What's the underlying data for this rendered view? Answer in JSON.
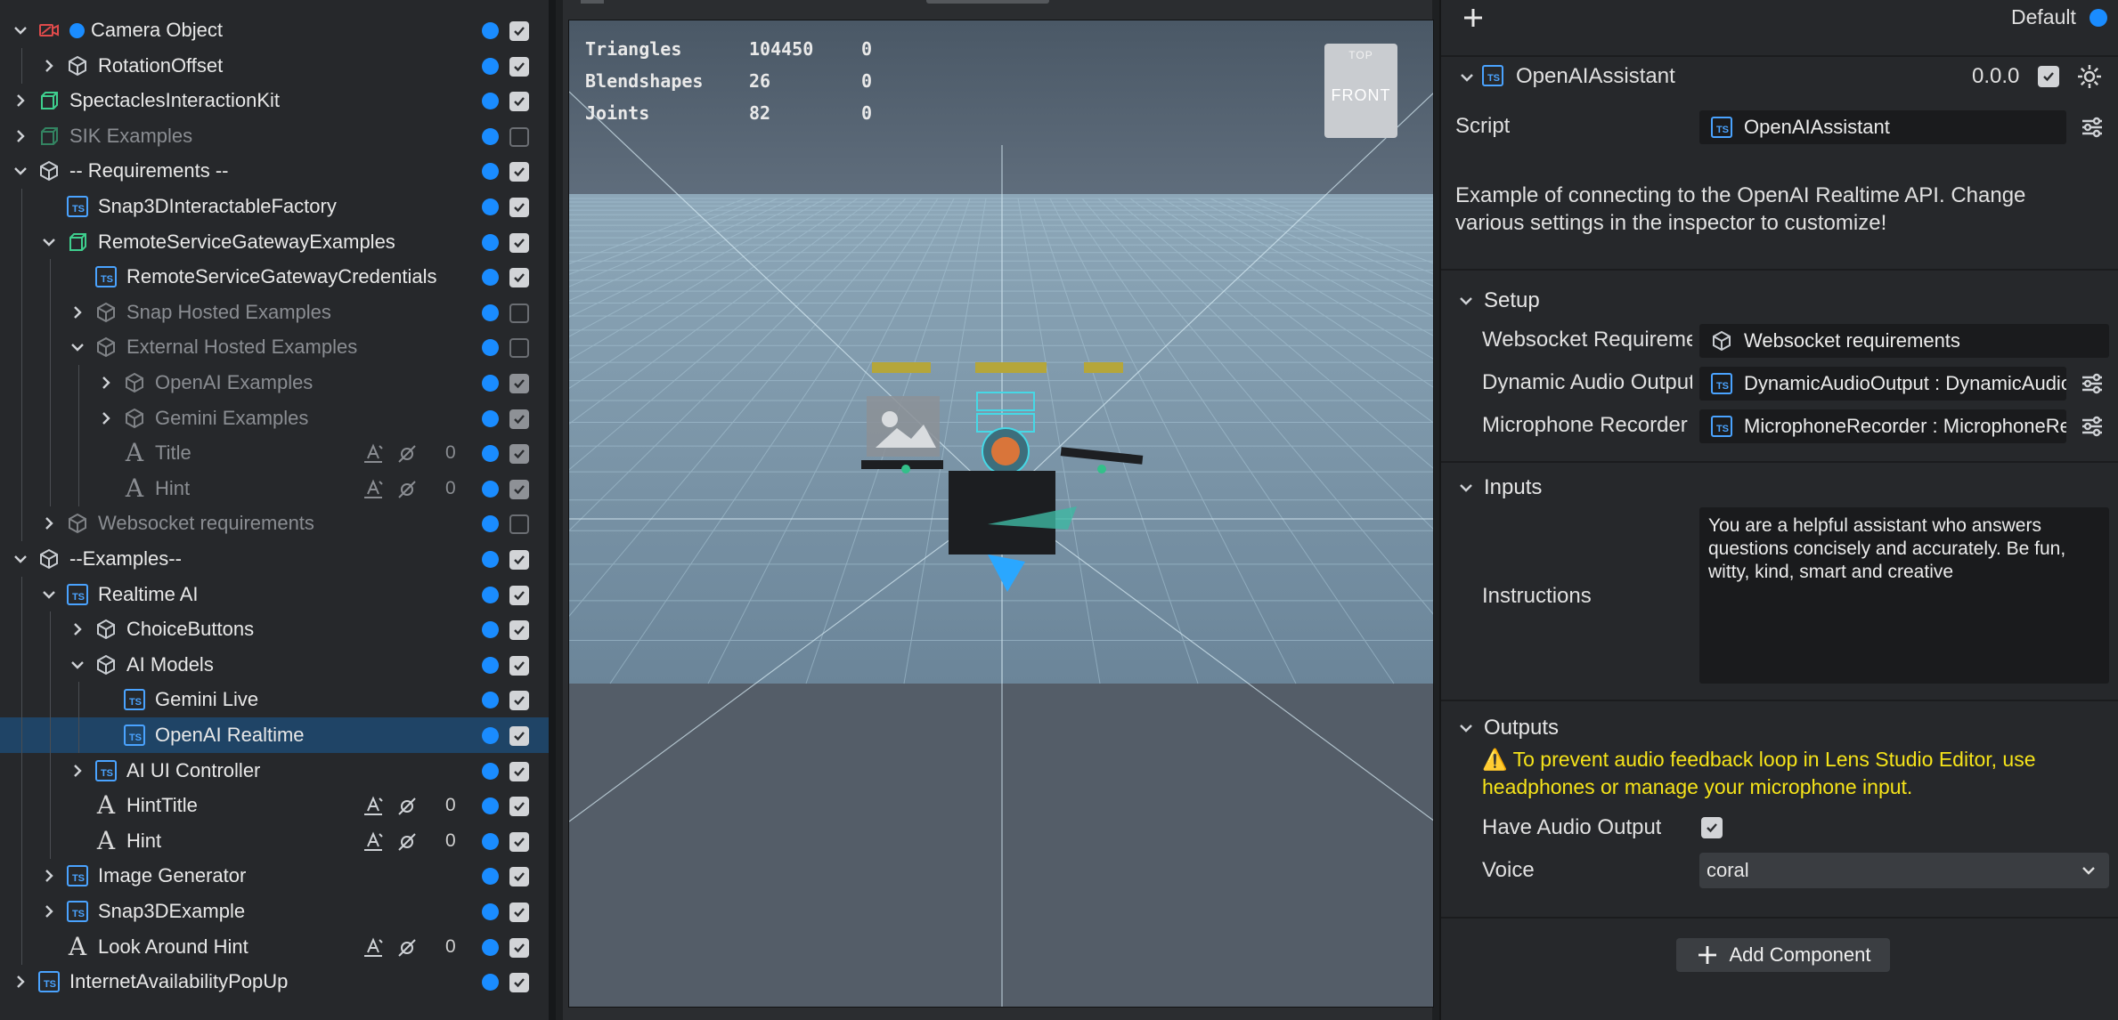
{
  "hierarchy": {
    "rows": [
      {
        "label": "Camera Object",
        "depth": 0,
        "expander": "open",
        "icon": "camera-icon",
        "dim": false,
        "enabled": true,
        "dot": true
      },
      {
        "label": "RotationOffset",
        "depth": 1,
        "expander": "closed",
        "icon": "object-icon",
        "dim": false,
        "enabled": true
      },
      {
        "label": "SpectaclesInteractionKit",
        "depth": 0,
        "expander": "closed",
        "icon": "prefab-icon",
        "dim": false,
        "enabled": true
      },
      {
        "label": "SIK Examples",
        "depth": 0,
        "expander": "closed",
        "icon": "prefab-icon",
        "dim": true,
        "enabled": false
      },
      {
        "label": "-- Requirements --",
        "depth": 0,
        "expander": "open",
        "icon": "object-icon",
        "dim": false,
        "enabled": true
      },
      {
        "label": "Snap3DInteractableFactory",
        "depth": 1,
        "expander": "none",
        "icon": "script-icon",
        "dim": false,
        "enabled": true
      },
      {
        "label": "RemoteServiceGatewayExamples",
        "depth": 1,
        "expander": "open",
        "icon": "prefab-icon",
        "dim": false,
        "enabled": true
      },
      {
        "label": "RemoteServiceGatewayCredentials",
        "depth": 2,
        "expander": "none",
        "icon": "script-icon",
        "dim": false,
        "enabled": true
      },
      {
        "label": "Snap Hosted Examples",
        "depth": 2,
        "expander": "closed",
        "icon": "object-icon",
        "dim": true,
        "enabled": false
      },
      {
        "label": "External Hosted Examples",
        "depth": 2,
        "expander": "open",
        "icon": "object-icon",
        "dim": true,
        "enabled": false
      },
      {
        "label": "OpenAI Examples",
        "depth": 3,
        "expander": "closed",
        "icon": "object-icon",
        "dim": true,
        "enabled": true
      },
      {
        "label": "Gemini Examples",
        "depth": 3,
        "expander": "closed",
        "icon": "object-icon",
        "dim": true,
        "enabled": true
      },
      {
        "label": "Title",
        "depth": 3,
        "expander": "none",
        "icon": "text-icon",
        "dim": true,
        "enabled": true,
        "tools": true,
        "count": "0"
      },
      {
        "label": "Hint",
        "depth": 3,
        "expander": "none",
        "icon": "text-icon",
        "dim": true,
        "enabled": true,
        "tools": true,
        "count": "0"
      },
      {
        "label": "Websocket requirements",
        "depth": 1,
        "expander": "closed",
        "icon": "object-icon",
        "dim": true,
        "enabled": false
      },
      {
        "label": "--Examples--",
        "depth": 0,
        "expander": "open",
        "icon": "object-icon",
        "dim": false,
        "enabled": true
      },
      {
        "label": "Realtime AI",
        "depth": 1,
        "expander": "open",
        "icon": "script-icon",
        "dim": false,
        "enabled": true
      },
      {
        "label": "ChoiceButtons",
        "depth": 2,
        "expander": "closed",
        "icon": "object-icon",
        "dim": false,
        "enabled": true
      },
      {
        "label": "AI Models",
        "depth": 2,
        "expander": "open",
        "icon": "object-icon",
        "dim": false,
        "enabled": true
      },
      {
        "label": "Gemini Live",
        "depth": 3,
        "expander": "none",
        "icon": "script-icon",
        "dim": false,
        "enabled": true
      },
      {
        "label": "OpenAI Realtime",
        "depth": 3,
        "expander": "none",
        "icon": "script-icon",
        "dim": false,
        "enabled": true,
        "selected": true
      },
      {
        "label": "AI UI Controller",
        "depth": 2,
        "expander": "closed",
        "icon": "script-icon",
        "dim": false,
        "enabled": true
      },
      {
        "label": "HintTitle",
        "depth": 2,
        "expander": "none",
        "icon": "text-icon",
        "dim": false,
        "enabled": true,
        "tools": true,
        "count": "0"
      },
      {
        "label": "Hint",
        "depth": 2,
        "expander": "none",
        "icon": "text-icon",
        "dim": false,
        "enabled": true,
        "tools": true,
        "count": "0"
      },
      {
        "label": "Image Generator",
        "depth": 1,
        "expander": "closed",
        "icon": "script-icon",
        "dim": false,
        "enabled": true
      },
      {
        "label": "Snap3DExample",
        "depth": 1,
        "expander": "closed",
        "icon": "script-icon",
        "dim": false,
        "enabled": true
      },
      {
        "label": "Look Around Hint",
        "depth": 1,
        "expander": "none",
        "icon": "text-icon",
        "dim": false,
        "enabled": true,
        "tools": true,
        "count": "0"
      },
      {
        "label": "InternetAvailabilityPopUp",
        "depth": 0,
        "expander": "closed",
        "icon": "script-icon",
        "dim": false,
        "enabled": true
      }
    ]
  },
  "viewport": {
    "stats": [
      {
        "name": "Triangles",
        "value": "104450",
        "extra": "0"
      },
      {
        "name": "Blendshapes",
        "value": "26",
        "extra": "0"
      },
      {
        "name": "Joints",
        "value": "82",
        "extra": "0"
      }
    ],
    "gizmo": {
      "top": "TOP",
      "front": "FRONT"
    }
  },
  "inspector": {
    "preset": "Default",
    "component": {
      "title": "OpenAIAssistant",
      "version": "0.0.0"
    },
    "script_label": "Script",
    "script_value": "OpenAIAssistant",
    "description": "Example of connecting to the OpenAI Realtime API. Change various settings in the inspector to customize!",
    "setup": {
      "heading": "Setup",
      "fields": [
        {
          "label": "Websocket Requirements",
          "value": "Websocket requirements",
          "icon": "object-icon",
          "sliders": false
        },
        {
          "label": "Dynamic Audio Output",
          "value": "DynamicAudioOutput : DynamicAudioOutput",
          "icon": "script-icon",
          "sliders": true
        },
        {
          "label": "Microphone Recorder",
          "value": "MicrophoneRecorder : MicrophoneRecorder",
          "icon": "script-icon",
          "sliders": true
        }
      ]
    },
    "inputs": {
      "heading": "Inputs",
      "instructions_label": "Instructions",
      "instructions_value": "You are a helpful assistant who answers questions concisely and accurately. Be fun, witty, kind, smart and creative"
    },
    "outputs": {
      "heading": "Outputs",
      "warning": "⚠️ To prevent audio feedback loop in Lens Studio Editor, use headphones or manage your microphone input.",
      "have_audio_label": "Have Audio Output",
      "have_audio_checked": true,
      "voice_label": "Voice",
      "voice_value": "coral"
    },
    "add_component": "Add Component"
  }
}
